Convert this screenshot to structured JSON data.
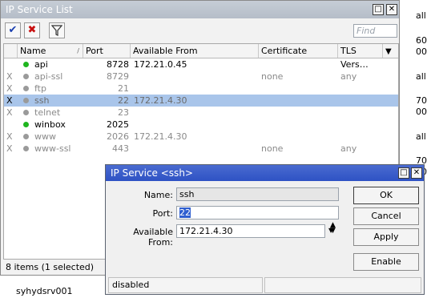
{
  "background_fragments": [
    "all",
    "60",
    "00",
    "all",
    "70",
    "00",
    "all",
    "70",
    "00"
  ],
  "main_window": {
    "title": "IP Service List",
    "minimize_glyph": "□",
    "close_glyph": "✕",
    "find_placeholder": "Find",
    "columns": [
      "Name",
      "Port",
      "Available From",
      "Certificate",
      "TLS Vers…"
    ],
    "rows": [
      {
        "flag": "",
        "name": "api",
        "port": "8728",
        "available_from": "172.21.0.45",
        "certificate": "",
        "tls": "",
        "status": "enabled"
      },
      {
        "flag": "X",
        "name": "api-ssl",
        "port": "8729",
        "available_from": "",
        "certificate": "none",
        "tls": "any",
        "status": "disabled"
      },
      {
        "flag": "X",
        "name": "ftp",
        "port": "21",
        "available_from": "",
        "certificate": "",
        "tls": "",
        "status": "disabled"
      },
      {
        "flag": "X",
        "name": "ssh",
        "port": "22",
        "available_from": "172.21.4.30",
        "certificate": "",
        "tls": "",
        "status": "disabled",
        "selected": true
      },
      {
        "flag": "X",
        "name": "telnet",
        "port": "23",
        "available_from": "",
        "certificate": "",
        "tls": "",
        "status": "disabled"
      },
      {
        "flag": "",
        "name": "winbox",
        "port": "2025",
        "available_from": "",
        "certificate": "",
        "tls": "",
        "status": "enabled"
      },
      {
        "flag": "X",
        "name": "www",
        "port": "2026",
        "available_from": "172.21.4.30",
        "certificate": "",
        "tls": "",
        "status": "disabled"
      },
      {
        "flag": "X",
        "name": "www-ssl",
        "port": "443",
        "available_from": "",
        "certificate": "none",
        "tls": "any",
        "status": "disabled"
      }
    ],
    "status_text": "8 items (1 selected)"
  },
  "below_label": "syhydsrv001",
  "dialog": {
    "title": "IP Service <ssh>",
    "name_label": "Name:",
    "name_value": "ssh",
    "port_label": "Port:",
    "port_value": "22",
    "available_label": "Available From:",
    "available_value": "172.21.4.30",
    "buttons": {
      "ok": "OK",
      "cancel": "Cancel",
      "apply": "Apply",
      "enable": "Enable"
    },
    "status": "disabled"
  },
  "colors": {
    "enabled_dot": "#1fb51f",
    "disabled_dot": "#9a9a9a",
    "selection": "#a9c5ea",
    "dialog_title": "#2e52c4"
  }
}
